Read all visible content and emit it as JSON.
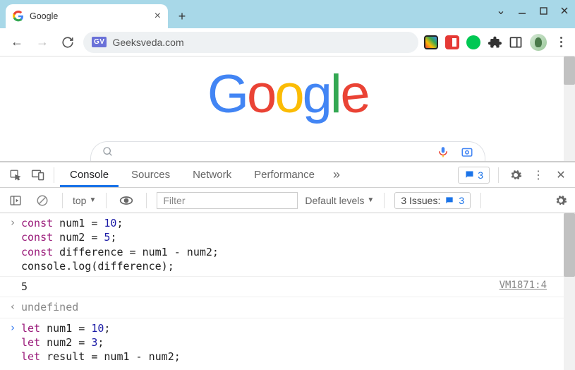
{
  "window": {
    "tab_title": "Google",
    "address": "Geeksveda.com",
    "site_badge": "GV"
  },
  "page": {
    "logo_letters": [
      "G",
      "o",
      "o",
      "g",
      "l",
      "e"
    ]
  },
  "devtools": {
    "tabs": [
      "Console",
      "Sources",
      "Network",
      "Performance"
    ],
    "active_tab": "Console",
    "messages_count": "3",
    "context": "top",
    "filter_placeholder": "Filter",
    "levels_label": "Default levels",
    "issues_label": "3 Issues:",
    "issues_count": "3"
  },
  "console": {
    "block1": {
      "l1_kw": "const",
      "l1_a": " num1 = ",
      "l1_n": "10",
      "l1_e": ";",
      "l2_kw": "const",
      "l2_a": " num2 = ",
      "l2_n": "5",
      "l2_e": ";",
      "l3_kw": "const",
      "l3_a": " difference = num1 - num2;",
      "l4": "console.log(difference);"
    },
    "output1": "5",
    "source1": "VM1871:4",
    "return1": "undefined",
    "block2": {
      "l1_kw": "let",
      "l1_a": " num1 = ",
      "l1_n": "10",
      "l1_e": ";",
      "l2_kw": "let",
      "l2_a": " num2 = ",
      "l2_n": "3",
      "l2_e": ";",
      "l3_kw": "let",
      "l3_a": " result = num1 - num2;"
    }
  }
}
